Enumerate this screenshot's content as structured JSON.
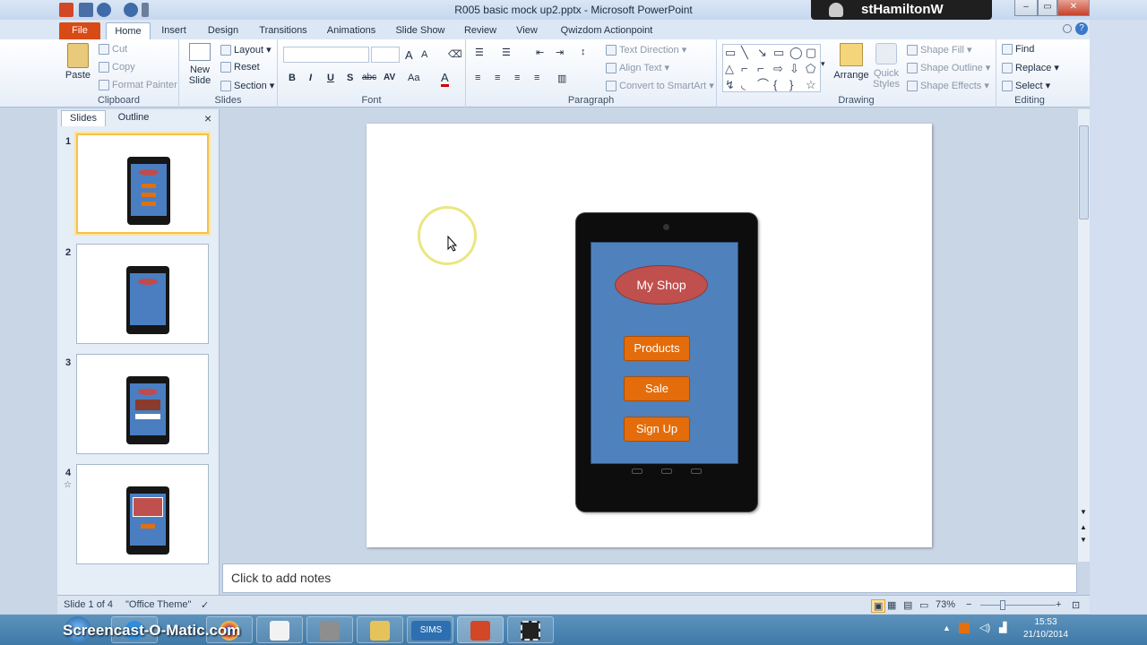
{
  "window": {
    "title": "R005 basic mock up2.pptx - Microsoft PowerPoint",
    "user": "stHamiltonW"
  },
  "tabs": [
    "File",
    "Home",
    "Insert",
    "Design",
    "Transitions",
    "Animations",
    "Slide Show",
    "Review",
    "View",
    "Qwizdom Actionpoint"
  ],
  "ribbon": {
    "clipboard": {
      "label": "Clipboard",
      "paste": "Paste",
      "cut": "Cut",
      "copy": "Copy",
      "format_painter": "Format Painter"
    },
    "slides": {
      "label": "Slides",
      "new_slide_1": "New",
      "new_slide_2": "Slide",
      "layout": "Layout",
      "reset": "Reset",
      "section": "Section"
    },
    "font": {
      "label": "Font",
      "bold": "B",
      "italic": "I",
      "underline": "U",
      "shadow": "S",
      "strike": "abc",
      "size_change": "AV",
      "case": "Aa",
      "color": "A"
    },
    "paragraph": {
      "label": "Paragraph",
      "text_direction": "Text Direction",
      "align_text": "Align Text",
      "convert_smartart": "Convert to SmartArt"
    },
    "drawing": {
      "label": "Drawing",
      "arrange": "Arrange",
      "quick_styles_1": "Quick",
      "quick_styles_2": "Styles",
      "shape_fill": "Shape Fill",
      "shape_outline": "Shape Outline",
      "shape_effects": "Shape Effects"
    },
    "editing": {
      "label": "Editing",
      "find": "Find",
      "replace": "Replace",
      "select": "Select"
    }
  },
  "panel": {
    "tab_slides": "Slides",
    "tab_outline": "Outline",
    "close": "×",
    "slides": [
      {
        "num": "1"
      },
      {
        "num": "2"
      },
      {
        "num": "3"
      },
      {
        "num": "4"
      }
    ]
  },
  "slide": {
    "shop": "My Shop",
    "buttons": [
      "Products",
      "Sale",
      "Sign Up"
    ]
  },
  "notes": {
    "placeholder": "Click to add notes"
  },
  "status": {
    "slide_of": "Slide 1 of 4",
    "theme": "\"Office Theme\"",
    "zoom": "73%"
  },
  "taskbar": {
    "watermark": "Screencast-O-Matic.com",
    "time": "15:53",
    "date": "21/10/2014",
    "sims": "SIMS"
  },
  "colors": {
    "screen_blue": "#4f81bd",
    "oval_red": "#c0504d",
    "button_orange": "#e46c0a",
    "file_tab": "#d84b16"
  }
}
